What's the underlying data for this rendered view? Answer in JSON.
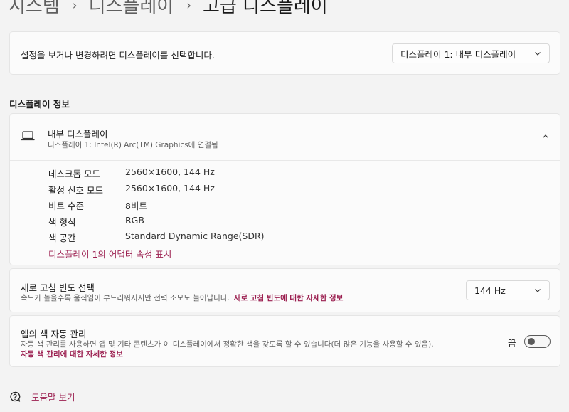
{
  "breadcrumb": {
    "items": [
      "시스템",
      "디스플레이",
      "고급 디스플레이"
    ],
    "separator": "›"
  },
  "select_display": {
    "description": "설정을 보거나 변경하려면 디스플레이를 선택합니다.",
    "selected": "디스플레이 1: 내부 디스플레이"
  },
  "display_info": {
    "section_title": "디스플레이 정보",
    "title": "내부 디스플레이",
    "subtitle": "디스플레이 1: Intel(R) Arc(TM) Graphics에 연결됨",
    "rows": [
      {
        "label": "데스크톱 모드",
        "value": "2560×1600, 144 Hz"
      },
      {
        "label": "활성 신호 모드",
        "value": "2560×1600, 144 Hz"
      },
      {
        "label": "비트 수준",
        "value": "8비트"
      },
      {
        "label": "색 형식",
        "value": "RGB"
      },
      {
        "label": "색 공간",
        "value": "Standard Dynamic Range(SDR)"
      }
    ],
    "adapter_link": "디스플레이 1의 어댑터 속성 표시"
  },
  "refresh_rate": {
    "title": "새로 고침 빈도 선택",
    "description": "속도가 높을수록 움직임이 부드러워지지만 전력 소모도 늘어납니다.",
    "link": "새로 고침 빈도에 대한 자세한 정보",
    "selected": "144 Hz"
  },
  "auto_color": {
    "title": "앱의 색 자동 관리",
    "description": "자동 색 관리를 사용하면 앱 및 기타 콘텐츠가 이 디스플레이에서 정확한 색을 갖도록 할 수 있습니다(더 많은 기능을 사용할 수 있음).",
    "link": "자동 색 관리에 대한 자세한 정보",
    "toggle_label": "끔",
    "toggle_on": false
  },
  "help": {
    "label": "도움말 보기"
  },
  "colors": {
    "accent_link": "#9b1e4f",
    "background": "#f3f3f3",
    "card": "#fbfbfb"
  }
}
